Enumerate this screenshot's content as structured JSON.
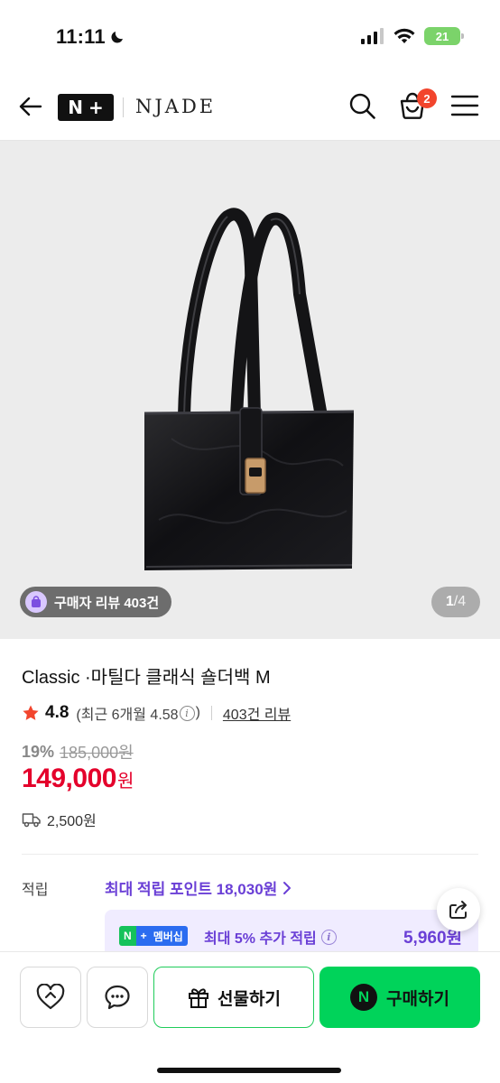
{
  "status_bar": {
    "time": "11:11",
    "battery": "21"
  },
  "header": {
    "nplus_logo_letters": [
      "N",
      "+"
    ],
    "brand": "NJADE",
    "cart_count": "2"
  },
  "gallery": {
    "review_chip": "구매자 리뷰 403건",
    "page_current": "1",
    "page_separator": "/",
    "page_total": "4"
  },
  "product": {
    "title": "Classic ·마틸다 클래식 숄더백 M",
    "rating": "4.8",
    "recent_rating_prefix": "(최근 6개월 4.58",
    "recent_rating_suffix": ")",
    "review_count_link": "403건 리뷰",
    "discount": "19%",
    "original_price": "185,000원",
    "sale_price": "149,000",
    "currency": "원",
    "shipping_fee": "2,500원"
  },
  "points": {
    "label": "적립",
    "max_points": "최대 적립 포인트 18,030원",
    "membership_badge": [
      "N",
      "+",
      "멤버십"
    ],
    "membership_text": "최대 5% 추가 적립",
    "membership_amount": "5,960원"
  },
  "bottom_bar": {
    "gift_label": "선물하기",
    "buy_label": "구매하기",
    "buy_logo": "N"
  },
  "colors": {
    "accent_purple": "#6a3fd6",
    "sale_red": "#e4002b",
    "naver_green": "#00d35a",
    "badge_red": "#f2452d"
  },
  "icons": [
    "moon-icon",
    "signal-icon",
    "wifi-icon",
    "back-arrow-icon",
    "search-icon",
    "cart-icon",
    "menu-icon",
    "star-icon",
    "info-icon",
    "truck-icon",
    "chevron-right-icon",
    "share-icon",
    "heart-icon",
    "chat-icon",
    "gift-icon"
  ]
}
